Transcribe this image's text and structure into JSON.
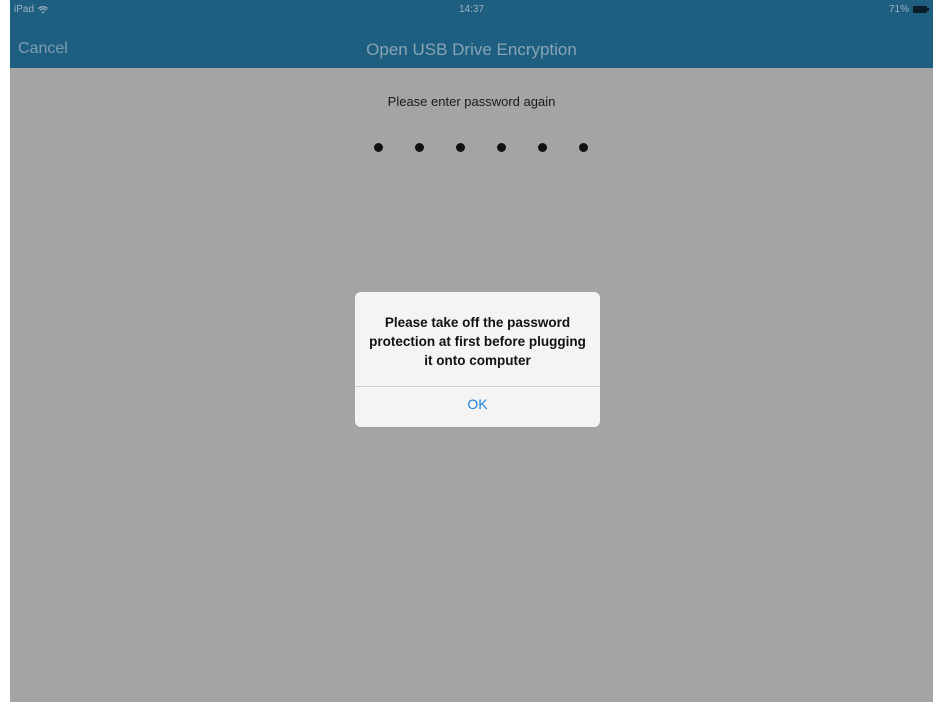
{
  "status_bar": {
    "device": "iPad",
    "time": "14:37",
    "battery": "71%"
  },
  "nav_bar": {
    "cancel_label": "Cancel",
    "title": "Open USB Drive Encryption"
  },
  "content": {
    "prompt": "Please enter password again",
    "password_dots_count": 6
  },
  "alert": {
    "message": "Please take off the password protection at first before plugging it onto computer",
    "ok_label": "OK"
  },
  "colors": {
    "nav_background": "#1e5e80",
    "dim_background": "#a4a4a4",
    "alert_button": "#1b7fd6"
  },
  "icons": {
    "wifi": "wifi-icon",
    "battery": "battery-icon"
  }
}
